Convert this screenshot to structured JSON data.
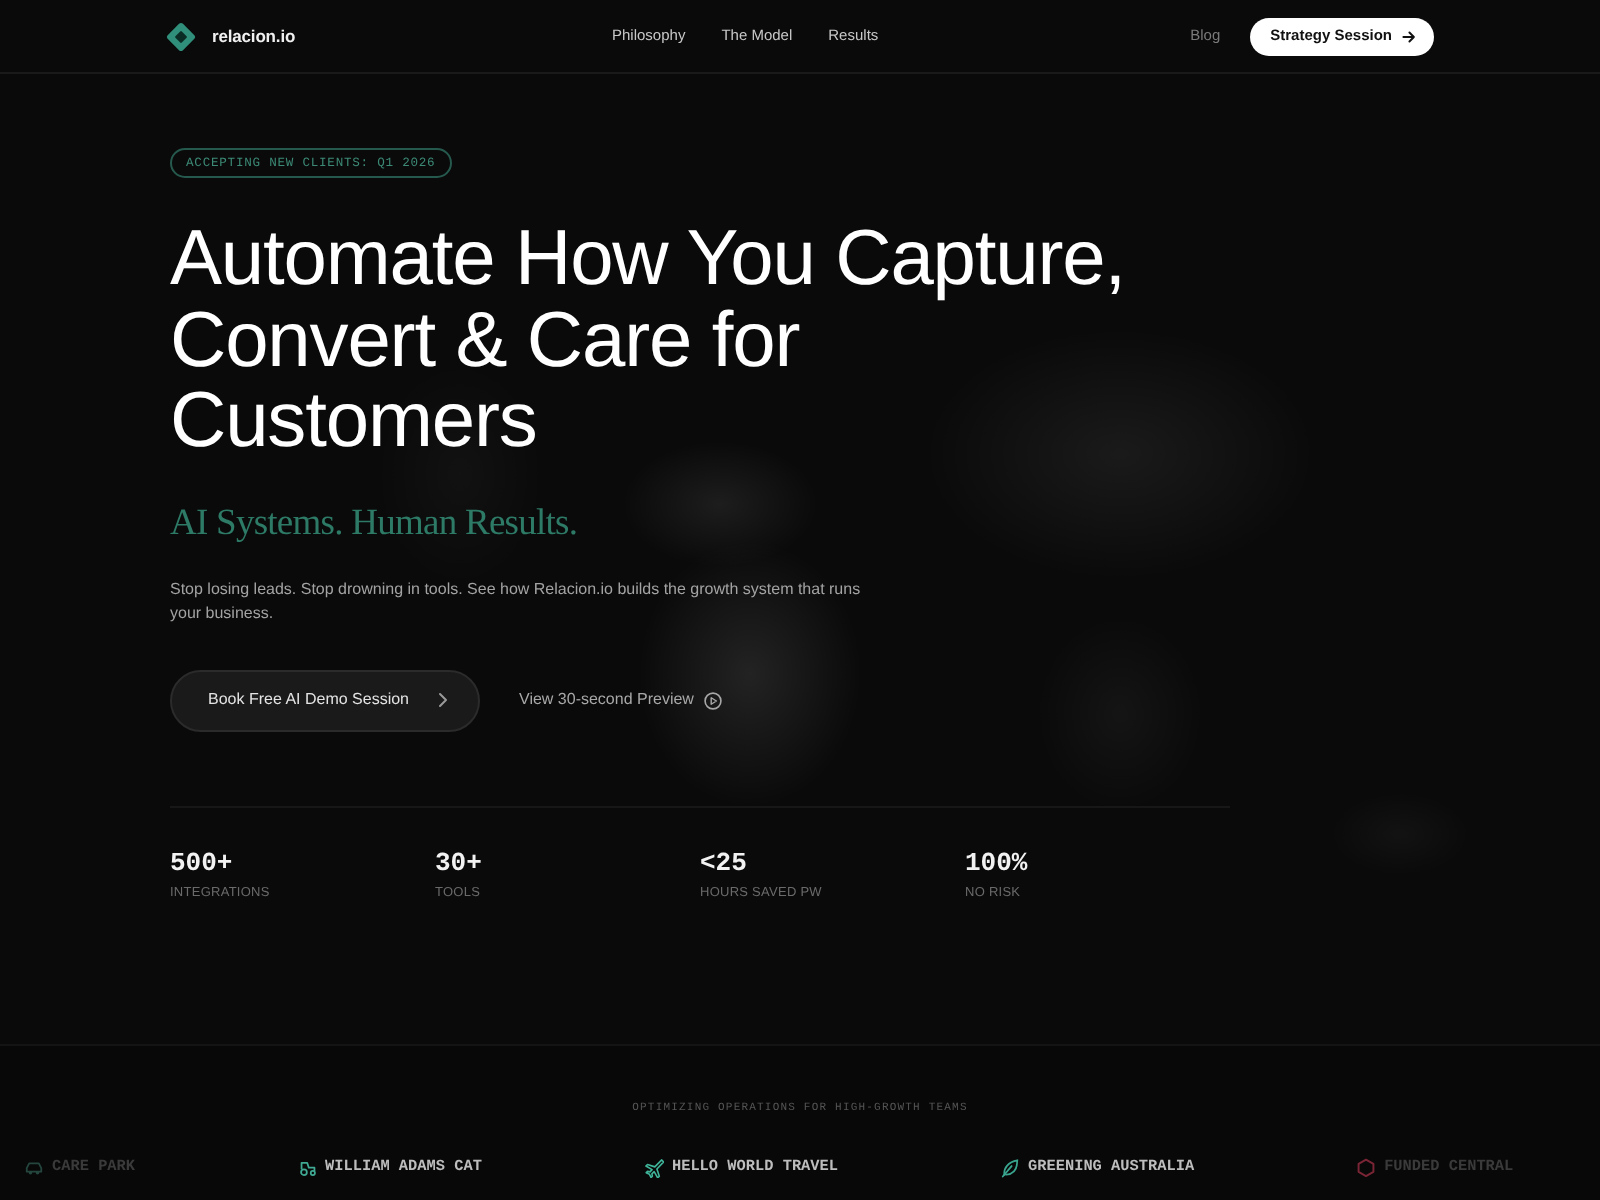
{
  "nav": {
    "brand": "relacion.io",
    "links": [
      {
        "label": "Philosophy"
      },
      {
        "label": "The Model"
      },
      {
        "label": "Results"
      }
    ],
    "blog": "Blog",
    "cta": "Strategy Session"
  },
  "hero": {
    "badge": "ACCEPTING NEW CLIENTS: Q1 2026",
    "title_lines": [
      "Automate How You Capture,",
      "Convert & Care for",
      "Customers"
    ],
    "tagline": "AI Systems. Human Results.",
    "description": "Stop losing leads. Stop drowning in tools. See how Relacion.io builds the growth system that runs your business.",
    "primary_button": "Book Free AI Demo Session",
    "secondary_link": "View 30-second Preview"
  },
  "stats": [
    {
      "value": "500+",
      "label": "INTEGRATIONS"
    },
    {
      "value": "30+",
      "label": "TOOLS"
    },
    {
      "value": "<25",
      "label": "HOURS SAVED PW"
    },
    {
      "value": "100%",
      "label": "NO RISK"
    }
  ],
  "clients": {
    "heading": "OPTIMIZING OPERATIONS FOR HIGH-GROWTH TEAMS",
    "logos": [
      {
        "name": "CARE PARK",
        "color": "#24463e",
        "dimmed": true
      },
      {
        "name": "WILLIAM ADAMS CAT",
        "color": "#3fa993",
        "dimmed": false
      },
      {
        "name": "HELLO WORLD TRAVEL",
        "color": "#3fb59a",
        "dimmed": false
      },
      {
        "name": "GREENING AUSTRALIA",
        "color": "#3aa58f",
        "dimmed": false
      },
      {
        "name": "FUNDED CENTRAL",
        "color": "#7a2535",
        "dimmed": true
      }
    ]
  }
}
